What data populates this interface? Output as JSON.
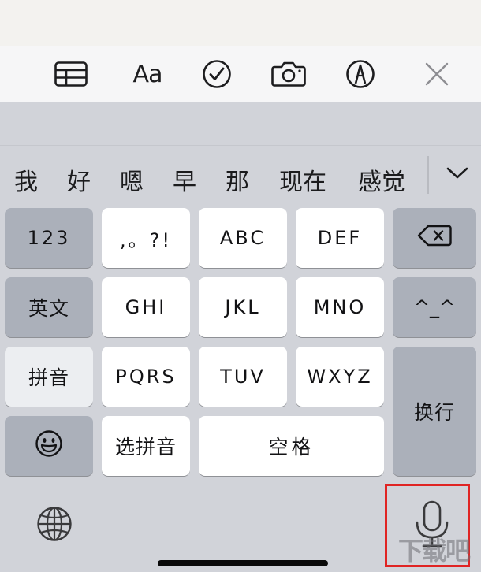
{
  "toolbar": {
    "icons": [
      "table-icon",
      "text-format-icon",
      "checklist-icon",
      "camera-icon",
      "markup-pen-icon",
      "close-icon"
    ],
    "format_label": "Aa"
  },
  "candidates": {
    "items": [
      "我",
      "好",
      "嗯",
      "早",
      "那",
      "现在",
      "感觉"
    ],
    "expand_icon": "chevron-down-icon"
  },
  "keys": {
    "row1": {
      "numbers": "123",
      "punct": ",。?!",
      "abc": "ABC",
      "def": "DEF",
      "delete_icon": "backspace-icon"
    },
    "row2": {
      "english": "英文",
      "ghi": "GHI",
      "jkl": "JKL",
      "mno": "MNO",
      "emoticon": "^_^"
    },
    "row3": {
      "pinyin": "拼音",
      "pqrs": "PQRS",
      "tuv": "TUV",
      "wxyz": "WXYZ",
      "return": "换行"
    },
    "row4": {
      "emoji_icon": "smiley-icon",
      "select_pinyin": "选拼音",
      "space": "空格"
    }
  },
  "bottom": {
    "globe_icon": "globe-icon",
    "mic_icon": "microphone-icon",
    "highlight_color": "#e02424"
  },
  "watermark": {
    "text": "下载吧"
  }
}
